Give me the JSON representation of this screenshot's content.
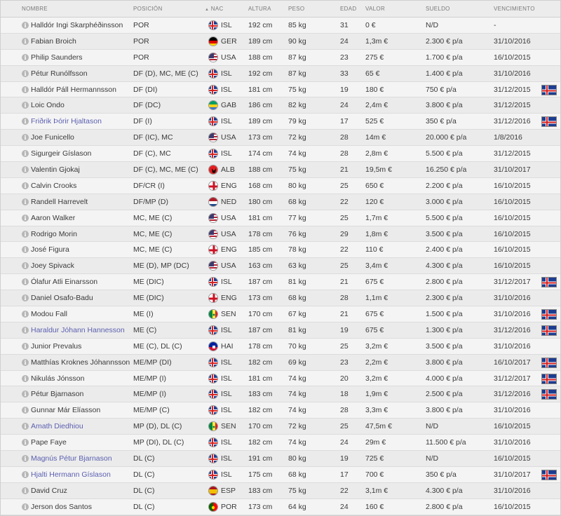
{
  "header": {
    "nombre": "NOMBRE",
    "posicion": "POSICIÓN",
    "nac": "NAC",
    "altura": "ALTURA",
    "peso": "PESO",
    "edad": "EDAD",
    "valor": "VALOR",
    "sueldo": "SUELDO",
    "vencimiento": "VENCIMIENTO",
    "nac_sort_icon": "sort-arrow-icon"
  },
  "colors": {
    "loan_name": "#5b5fb0",
    "ISL": [
      "#1c3c8f",
      "#ffffff",
      "#d62020"
    ],
    "GER": [
      "#000000",
      "#dd0000",
      "#ffce00"
    ],
    "USA": [
      "#b22234",
      "#ffffff",
      "#3c3b6e"
    ],
    "GAB": [
      "#009e60",
      "#fcd116",
      "#3a75c4"
    ],
    "ALB": [
      "#e41e20",
      "#000000"
    ],
    "ENG": [
      "#ffffff",
      "#ce1124"
    ],
    "NED": [
      "#ae1c28",
      "#ffffff",
      "#21468b"
    ],
    "SEN": [
      "#00853f",
      "#fdef42",
      "#e31b23"
    ],
    "HAI": [
      "#00209f",
      "#d21034"
    ],
    "ESP": [
      "#aa151b",
      "#f1bf00"
    ],
    "POR": [
      "#006600",
      "#ff0000"
    ]
  },
  "players": [
    {
      "name": "Halldór Ingi Skarphéðinsson",
      "loan": false,
      "pos": "POR",
      "nat": "ISL",
      "height": "192 cm",
      "weight": "85 kg",
      "age": "31",
      "value": "0 €",
      "wage": "N/D",
      "expiry": "-",
      "emblem": false
    },
    {
      "name": "Fabian Broich",
      "loan": false,
      "pos": "POR",
      "nat": "GER",
      "height": "189 cm",
      "weight": "90 kg",
      "age": "24",
      "value": "1,3m €",
      "wage": "2.300 € p/a",
      "expiry": "31/10/2016",
      "emblem": false
    },
    {
      "name": "Philip Saunders",
      "loan": false,
      "pos": "POR",
      "nat": "USA",
      "height": "188 cm",
      "weight": "87 kg",
      "age": "23",
      "value": "275 €",
      "wage": "1.700 € p/a",
      "expiry": "16/10/2015",
      "emblem": false
    },
    {
      "name": "Pétur Runólfsson",
      "loan": false,
      "pos": "DF (D), MC, ME (C)",
      "nat": "ISL",
      "height": "192 cm",
      "weight": "87 kg",
      "age": "33",
      "value": "65 €",
      "wage": "1.400 € p/a",
      "expiry": "31/10/2016",
      "emblem": false
    },
    {
      "name": "Halldór Páll Hermannsson",
      "loan": false,
      "pos": "DF (DI)",
      "nat": "ISL",
      "height": "181 cm",
      "weight": "75 kg",
      "age": "19",
      "value": "180 €",
      "wage": "750 € p/a",
      "expiry": "31/12/2015",
      "emblem": true
    },
    {
      "name": "Loic Ondo",
      "loan": false,
      "pos": "DF (DC)",
      "nat": "GAB",
      "height": "186 cm",
      "weight": "82 kg",
      "age": "24",
      "value": "2,4m €",
      "wage": "3.800 € p/a",
      "expiry": "31/12/2015",
      "emblem": false
    },
    {
      "name": "Friðrik Þórir Hjaltason",
      "loan": true,
      "pos": "DF (I)",
      "nat": "ISL",
      "height": "189 cm",
      "weight": "79 kg",
      "age": "17",
      "value": "525 €",
      "wage": "350 € p/a",
      "expiry": "31/12/2016",
      "emblem": true
    },
    {
      "name": "Joe Funicello",
      "loan": false,
      "pos": "DF (IC), MC",
      "nat": "USA",
      "height": "173 cm",
      "weight": "72 kg",
      "age": "28",
      "value": "14m €",
      "wage": "20.000 € p/a",
      "expiry": "1/8/2016",
      "emblem": false
    },
    {
      "name": "Sigurgeir Gíslason",
      "loan": false,
      "pos": "DF (C), MC",
      "nat": "ISL",
      "height": "174 cm",
      "weight": "74 kg",
      "age": "28",
      "value": "2,8m €",
      "wage": "5.500 € p/a",
      "expiry": "31/12/2015",
      "emblem": false
    },
    {
      "name": "Valentin Gjokaj",
      "loan": false,
      "pos": "DF (C), MC, ME (C)",
      "nat": "ALB",
      "height": "188 cm",
      "weight": "75 kg",
      "age": "21",
      "value": "19,5m €",
      "wage": "16.250 € p/a",
      "expiry": "31/10/2017",
      "emblem": false
    },
    {
      "name": "Calvin Crooks",
      "loan": false,
      "pos": "DF/CR (I)",
      "nat": "ENG",
      "height": "168 cm",
      "weight": "80 kg",
      "age": "25",
      "value": "650 €",
      "wage": "2.200 € p/a",
      "expiry": "16/10/2015",
      "emblem": false
    },
    {
      "name": "Randell Harrevelt",
      "loan": false,
      "pos": "DF/MP (D)",
      "nat": "NED",
      "height": "180 cm",
      "weight": "68 kg",
      "age": "22",
      "value": "120 €",
      "wage": "3.000 € p/a",
      "expiry": "16/10/2015",
      "emblem": false
    },
    {
      "name": "Aaron Walker",
      "loan": false,
      "pos": "MC, ME (C)",
      "nat": "USA",
      "height": "181 cm",
      "weight": "77 kg",
      "age": "25",
      "value": "1,7m €",
      "wage": "5.500 € p/a",
      "expiry": "16/10/2015",
      "emblem": false
    },
    {
      "name": "Rodrigo Morin",
      "loan": false,
      "pos": "MC, ME (C)",
      "nat": "USA",
      "height": "178 cm",
      "weight": "76 kg",
      "age": "29",
      "value": "1,8m €",
      "wage": "3.500 € p/a",
      "expiry": "16/10/2015",
      "emblem": false
    },
    {
      "name": "José Figura",
      "loan": false,
      "pos": "MC, ME (C)",
      "nat": "ENG",
      "height": "185 cm",
      "weight": "78 kg",
      "age": "22",
      "value": "110 €",
      "wage": "2.400 € p/a",
      "expiry": "16/10/2015",
      "emblem": false
    },
    {
      "name": "Joey Spivack",
      "loan": false,
      "pos": "ME (D), MP (DC)",
      "nat": "USA",
      "height": "163 cm",
      "weight": "63 kg",
      "age": "25",
      "value": "3,4m €",
      "wage": "4.300 € p/a",
      "expiry": "16/10/2015",
      "emblem": false
    },
    {
      "name": "Ólafur Atli Einarsson",
      "loan": false,
      "pos": "ME (DIC)",
      "nat": "ISL",
      "height": "187 cm",
      "weight": "81 kg",
      "age": "21",
      "value": "675 €",
      "wage": "2.800 € p/a",
      "expiry": "31/12/2017",
      "emblem": true
    },
    {
      "name": "Daniel Osafo-Badu",
      "loan": false,
      "pos": "ME (DIC)",
      "nat": "ENG",
      "height": "173 cm",
      "weight": "68 kg",
      "age": "28",
      "value": "1,1m €",
      "wage": "2.300 € p/a",
      "expiry": "31/10/2016",
      "emblem": false
    },
    {
      "name": "Modou Fall",
      "loan": false,
      "pos": "ME (I)",
      "nat": "SEN",
      "height": "170 cm",
      "weight": "67 kg",
      "age": "21",
      "value": "675 €",
      "wage": "1.500 € p/a",
      "expiry": "31/10/2016",
      "emblem": true
    },
    {
      "name": "Haraldur Jóhann Hannesson",
      "loan": true,
      "pos": "ME (C)",
      "nat": "ISL",
      "height": "187 cm",
      "weight": "81 kg",
      "age": "19",
      "value": "675 €",
      "wage": "1.300 € p/a",
      "expiry": "31/12/2016",
      "emblem": true
    },
    {
      "name": "Junior Prevalus",
      "loan": false,
      "pos": "ME (C), DL (C)",
      "nat": "HAI",
      "height": "178 cm",
      "weight": "70 kg",
      "age": "25",
      "value": "3,2m €",
      "wage": "3.500 € p/a",
      "expiry": "31/10/2016",
      "emblem": false
    },
    {
      "name": "Matthías Kroknes Jóhannsson",
      "loan": false,
      "pos": "ME/MP (DI)",
      "nat": "ISL",
      "height": "182 cm",
      "weight": "69 kg",
      "age": "23",
      "value": "2,2m €",
      "wage": "3.800 € p/a",
      "expiry": "16/10/2017",
      "emblem": true
    },
    {
      "name": "Nikulás Jónsson",
      "loan": false,
      "pos": "ME/MP (I)",
      "nat": "ISL",
      "height": "181 cm",
      "weight": "74 kg",
      "age": "20",
      "value": "3,2m €",
      "wage": "4.000 € p/a",
      "expiry": "31/12/2017",
      "emblem": true
    },
    {
      "name": "Pétur Bjarnason",
      "loan": false,
      "pos": "ME/MP (I)",
      "nat": "ISL",
      "height": "183 cm",
      "weight": "74 kg",
      "age": "18",
      "value": "1,9m €",
      "wage": "2.500 € p/a",
      "expiry": "31/12/2016",
      "emblem": true
    },
    {
      "name": "Gunnar Már Elíasson",
      "loan": false,
      "pos": "ME/MP (C)",
      "nat": "ISL",
      "height": "182 cm",
      "weight": "74 kg",
      "age": "28",
      "value": "3,3m €",
      "wage": "3.800 € p/a",
      "expiry": "31/10/2016",
      "emblem": false
    },
    {
      "name": "Amath Diedhiou",
      "loan": true,
      "pos": "MP (D), DL (C)",
      "nat": "SEN",
      "height": "170 cm",
      "weight": "72 kg",
      "age": "25",
      "value": "47,5m €",
      "wage": "N/D",
      "expiry": "16/10/2015",
      "emblem": false
    },
    {
      "name": "Pape Faye",
      "loan": false,
      "pos": "MP (DI), DL (C)",
      "nat": "ISL",
      "height": "182 cm",
      "weight": "74 kg",
      "age": "24",
      "value": "29m €",
      "wage": "11.500 € p/a",
      "expiry": "31/10/2016",
      "emblem": false
    },
    {
      "name": "Magnús Pétur Bjarnason",
      "loan": true,
      "pos": "DL (C)",
      "nat": "ISL",
      "height": "191 cm",
      "weight": "80 kg",
      "age": "19",
      "value": "725 €",
      "wage": "N/D",
      "expiry": "16/10/2015",
      "emblem": false
    },
    {
      "name": "Hjalti Hermann Gíslason",
      "loan": true,
      "pos": "DL (C)",
      "nat": "ISL",
      "height": "175 cm",
      "weight": "68 kg",
      "age": "17",
      "value": "700 €",
      "wage": "350 € p/a",
      "expiry": "31/10/2017",
      "emblem": true
    },
    {
      "name": "David Cruz",
      "loan": false,
      "pos": "DL (C)",
      "nat": "ESP",
      "height": "183 cm",
      "weight": "75 kg",
      "age": "22",
      "value": "3,1m €",
      "wage": "4.300 € p/a",
      "expiry": "31/10/2016",
      "emblem": false
    },
    {
      "name": "Jerson dos Santos",
      "loan": false,
      "pos": "DL (C)",
      "nat": "POR",
      "height": "173 cm",
      "weight": "64 kg",
      "age": "24",
      "value": "160 €",
      "wage": "2.800 € p/a",
      "expiry": "16/10/2015",
      "emblem": false
    }
  ]
}
